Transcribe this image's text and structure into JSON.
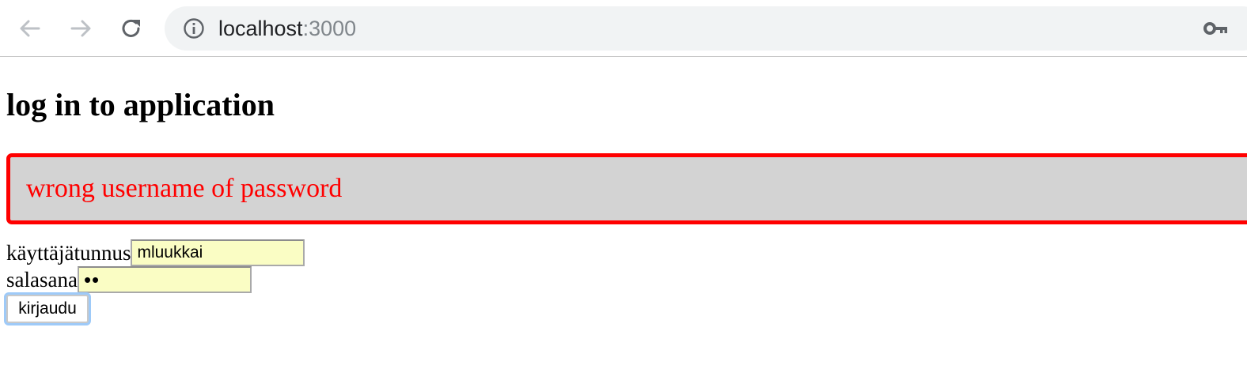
{
  "browser": {
    "url_host": "localhost",
    "url_port": ":3000",
    "icons": {
      "back": "arrow-left-icon",
      "forward": "arrow-right-icon",
      "reload": "reload-icon",
      "site_info": "info-icon",
      "passwords": "key-icon"
    }
  },
  "page": {
    "title": "log in to application",
    "error_message": "wrong username of password",
    "error_colors": {
      "text": "#ff0000",
      "border": "#ff0000",
      "background": "#d3d3d3"
    },
    "form": {
      "username_label": "käyttäjätunnus",
      "username_value": "mluukkai",
      "password_label": "salasana",
      "password_masked": "••",
      "submit_label": "kirjaudu",
      "autofill_color": "#fafdc4"
    }
  }
}
